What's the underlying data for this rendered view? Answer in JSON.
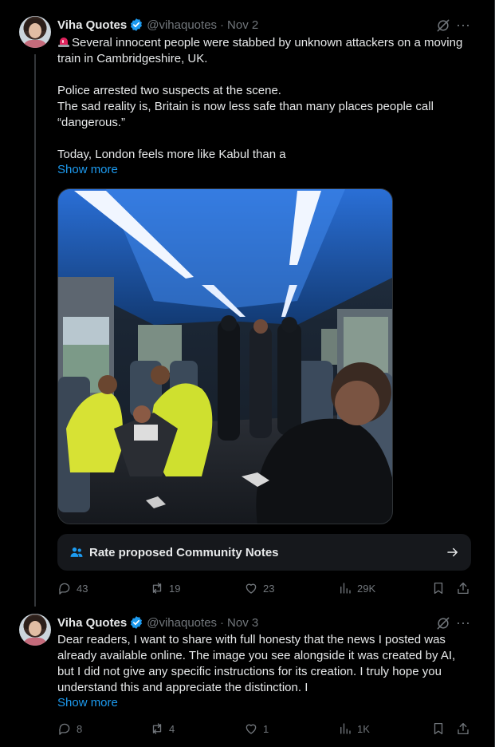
{
  "posts": [
    {
      "author": {
        "name": "Viha Quotes",
        "handle": "@vihaquotes",
        "date": "Nov 2",
        "verified": true,
        "avatar": "avatar-woman-portrait"
      },
      "text_lines": [
        "Several innocent people were stabbed by unknown attackers on a moving train in Cambridgeshire, UK.",
        "",
        "Police arrested two suspects at the scene.",
        "The sad reality is, Britain is now less safe than many places people call “dangerous.”",
        "",
        "Today, London feels more like Kabul than a"
      ],
      "leading_icon": "police-siren-emoji",
      "show_more": "Show more",
      "media": {
        "type": "image",
        "subject": "train-carriage-police-paramedics"
      },
      "community_notes": {
        "label": "Rate proposed Community Notes",
        "icon": "people-icon"
      },
      "metrics": {
        "replies": "43",
        "reposts": "19",
        "likes": "23",
        "views": "29K"
      }
    },
    {
      "author": {
        "name": "Viha Quotes",
        "handle": "@vihaquotes",
        "date": "Nov 3",
        "verified": true,
        "avatar": "avatar-woman-portrait"
      },
      "text_lines": [
        "Dear readers, I want to share with full honesty that the news I posted was already available online. The image you see alongside it was created by AI, but I did not give any specific instructions for its creation. I truly hope you understand this and appreciate the distinction. I"
      ],
      "show_more": "Show more",
      "metrics": {
        "replies": "8",
        "reposts": "4",
        "likes": "1",
        "views": "1K"
      }
    }
  ],
  "colors": {
    "background": "#000000",
    "text": "#e7e9ea",
    "muted": "#71767b",
    "accent": "#1d9bf0",
    "card": "#16181c"
  }
}
